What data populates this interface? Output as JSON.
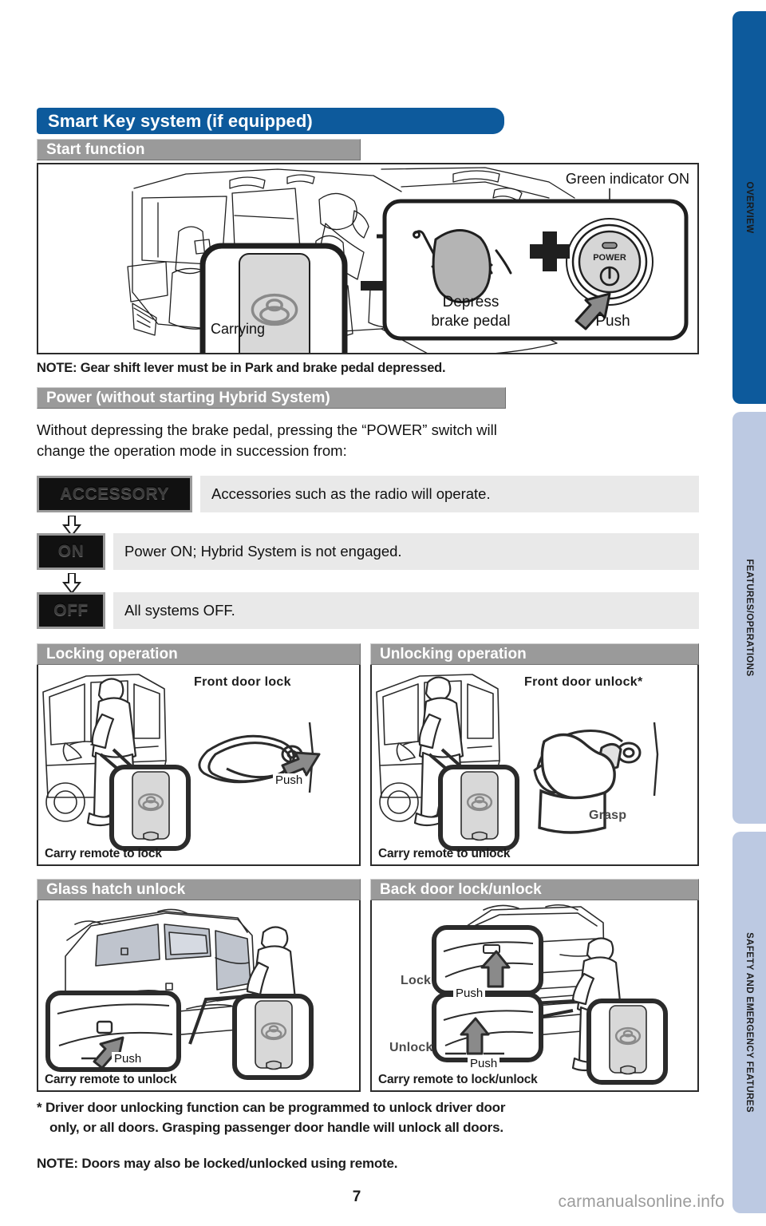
{
  "document": {
    "page_number": "7",
    "watermark": "carmanualsonline.info"
  },
  "side_tabs": [
    {
      "label": "OVERVIEW",
      "color": "#0d5a9c",
      "active": true
    },
    {
      "label": "FEATURES/OPERATIONS",
      "color": "#bcc9e2",
      "active": false
    },
    {
      "label": "SAFETY AND EMERGENCY FEATURES",
      "color": "#bcc9e2",
      "active": false
    }
  ],
  "title_bar": {
    "text": "Smart Key system (if equipped)",
    "color": "#0d5a9c"
  },
  "start_function": {
    "heading": "Start function",
    "carrying_label": "Carrying",
    "green_indicator_label": "Green indicator ON",
    "depress_label_line1": "Depress",
    "depress_label_line2": "brake pedal",
    "push_label": "Push",
    "power_switch_text": "POWER",
    "plus_symbol": "+",
    "note": "NOTE: Gear shift lever must be in Park and brake pedal depressed."
  },
  "power_section": {
    "heading": "Power (without starting Hybrid System)",
    "intro_line1": "Without depressing the brake pedal, pressing the “POWER” switch will",
    "intro_line2": "change the operation mode in succession from:",
    "modes": [
      {
        "badge": "ACCESSORY",
        "description": "Accessories such as the radio will operate."
      },
      {
        "badge": "ON",
        "description": "Power ON; Hybrid System is not engaged."
      },
      {
        "badge": "OFF",
        "description": "All systems OFF."
      }
    ]
  },
  "panels": {
    "locking": {
      "heading": "Locking operation",
      "tag": "Front door lock",
      "action": "Push",
      "caption": "Carry remote to lock"
    },
    "unlocking": {
      "heading": "Unlocking operation",
      "tag": "Front door unlock*",
      "action": "Grasp",
      "caption": "Carry remote to unlock"
    },
    "glass_hatch": {
      "heading": "Glass hatch unlock",
      "action": "Push",
      "caption": "Carry remote to unlock"
    },
    "back_door": {
      "heading": "Back door lock/unlock",
      "lock_label": "Lock",
      "unlock_label": "Unlock",
      "action_lock": "Push",
      "action_unlock": "Push",
      "caption": "Carry remote to lock/unlock"
    }
  },
  "footnotes": {
    "star_line1": "* Driver door unlocking function can be programmed to unlock driver door",
    "star_line2": "only, or all doors. Grasping passenger door handle will unlock all doors.",
    "note": "NOTE: Doors may also be locked/unlocked using remote."
  }
}
